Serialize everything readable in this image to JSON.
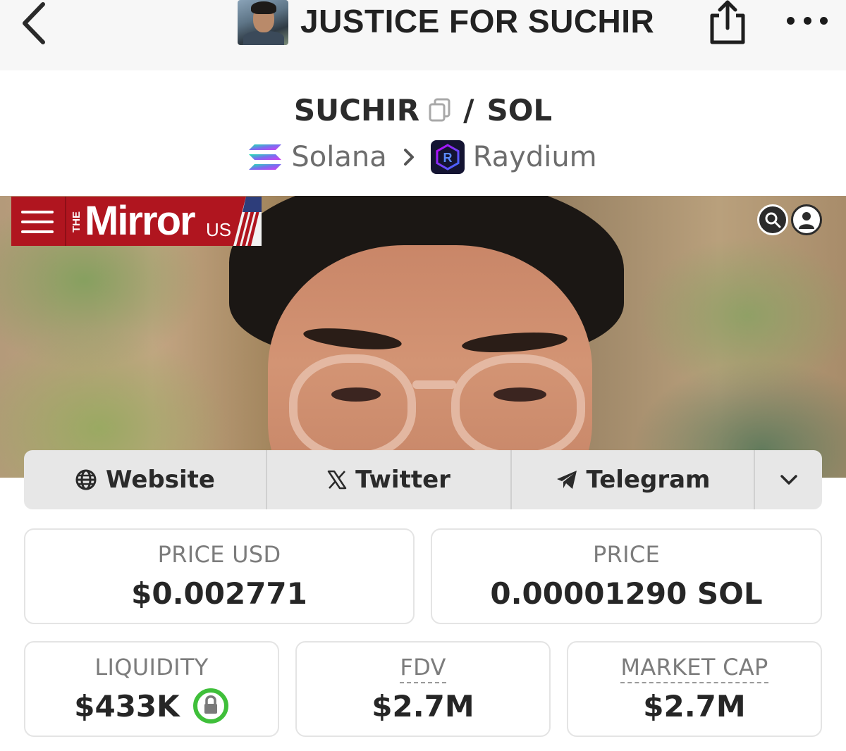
{
  "nav": {
    "title": "JUSTICE FOR SUCHIR",
    "back_icon": "chevron-left-icon",
    "share_icon": "share-icon",
    "more_icon": "more-horizontal-icon"
  },
  "pair": {
    "base": "SUCHIR",
    "separator": "/",
    "quote": "SOL"
  },
  "chain": {
    "network": "Solana",
    "dex": "Raydium"
  },
  "banner": {
    "logo_prefix": "THE",
    "logo_name": "Mirror",
    "logo_suffix": "US",
    "brand_color": "#b0151f"
  },
  "links": [
    {
      "label": "Website",
      "icon": "globe-icon"
    },
    {
      "label": "Twitter",
      "icon": "x-logo-icon"
    },
    {
      "label": "Telegram",
      "icon": "telegram-icon"
    }
  ],
  "stats": {
    "price_usd": {
      "label": "PRICE USD",
      "value": "$0.002771"
    },
    "price": {
      "label": "PRICE",
      "value": "0.00001290 SOL"
    },
    "liquidity": {
      "label": "LIQUIDITY",
      "value": "$433K",
      "locked": true
    },
    "fdv": {
      "label": "FDV",
      "value": "$2.7M"
    },
    "market_cap": {
      "label": "MARKET CAP",
      "value": "$2.7M"
    }
  },
  "colors": {
    "lock_green": "#3fbf3a",
    "card_border": "#e4e4e4",
    "links_bg": "#e7e7e7"
  }
}
